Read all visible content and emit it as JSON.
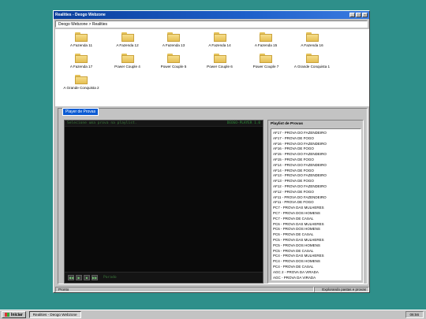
{
  "window": {
    "title": "Realities - Deogo Webzone",
    "minimize_glyph": "_",
    "maximize_glyph": "□",
    "close_glyph": "×"
  },
  "address": {
    "path": "Deogo Webzone > Realities"
  },
  "folders": [
    "A Fazenda 11",
    "A Fazenda 12",
    "A Fazenda 13",
    "A Fazenda 14",
    "A Fazenda 15",
    "A Fazenda 16",
    "A Fazenda 17",
    "Power Couple 4",
    "Power Couple 5",
    "Power Couple 6",
    "Power Couple 7",
    "A Grande Conquista 1",
    "A Grande Conquista 2"
  ],
  "panel": {
    "tab_label": "Player de Provas"
  },
  "player": {
    "message": "Selecione uma prova na playlist.",
    "brand": "DEOGO-PLAYER 1.0",
    "status": "Parado",
    "controls": [
      {
        "name": "rewind-icon",
        "glyph": "◀◀"
      },
      {
        "name": "play-icon",
        "glyph": "▶"
      },
      {
        "name": "stop-icon",
        "glyph": "■"
      },
      {
        "name": "forward-icon",
        "glyph": "▶▶"
      }
    ]
  },
  "playlist": {
    "title": "Playlist de Provas",
    "items": [
      "AF17 - PROVA DO FAZENDEIRO",
      "AF17 - PROVA DE FOGO",
      "AF16 - PROVA DO FAZENDEIRO",
      "AF16 - PROVA DE FOGO",
      "AF15 - PROVA DO FAZENDEIRO",
      "AF15 - PROVA DE FOGO",
      "AF14 - PROVA DO FAZENDEIRO",
      "AF14 - PROVA DE FOGO",
      "AF13 - PROVA DO FAZENDEIRO",
      "AF13 - PROVA DE FOGO",
      "AF12 - PROVA DO FAZENDEIRO",
      "AF12 - PROVA DE FOGO",
      "AF11 - PROVA DO FAZENDEIRO",
      "AF11 - PROVA DE FOGO",
      "PC7 - PROVA DAS MULHERES",
      "PC7 - PROVA DOS HOMENS",
      "PC7 - PROVA DE CASAL",
      "PC6 - PROVA DAS MULHERES",
      "PC6 - PROVA DOS HOMENS",
      "PC6 - PROVA DE CASAL",
      "PC5 - PROVA DAS MULHERES",
      "PC5 - PROVA DOS HOMENS",
      "PC5 - PROVA DE CASAL",
      "PC4 - PROVA DAS MULHERES",
      "PC4 - PROVA DOS HOMENS",
      "PC4 - PROVA DE CASAL",
      "AGC 2 - PROVA DA VIRADA",
      "AGC - PROVA DA VIRADA"
    ]
  },
  "statusbar": {
    "left": "Pronto",
    "right": "Explorando pastas e provas"
  },
  "taskbar": {
    "start_label": "Iniciar",
    "task_label": "Realities - Deogo Webzone",
    "clock": "06:56"
  }
}
